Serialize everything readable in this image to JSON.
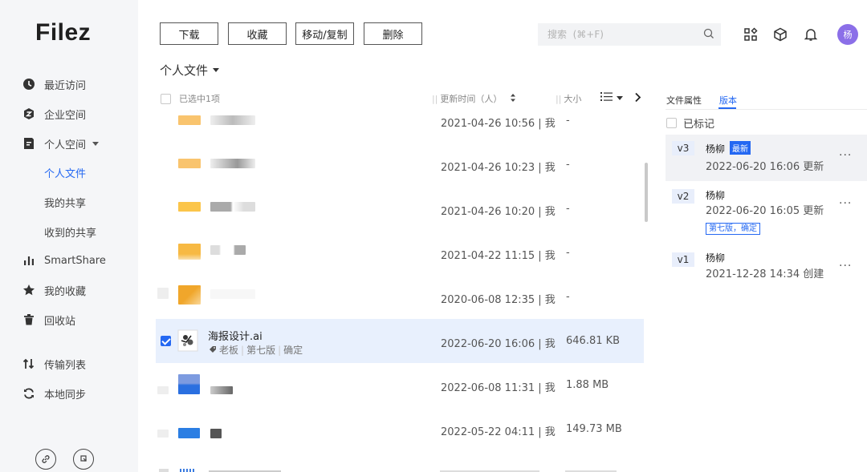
{
  "app": {
    "logo": "Filez"
  },
  "sidebar": {
    "items": [
      {
        "label": "最近访问",
        "icon": "clock-icon"
      },
      {
        "label": "企业空间",
        "icon": "enterprise-icon"
      },
      {
        "label": "个人空间",
        "icon": "personal-space-icon"
      },
      {
        "label": "SmartShare",
        "icon": "bar-chart-icon"
      },
      {
        "label": "我的收藏",
        "icon": "star-icon"
      },
      {
        "label": "回收站",
        "icon": "trash-icon"
      },
      {
        "label": "传输列表",
        "icon": "transfer-icon"
      },
      {
        "label": "本地同步",
        "icon": "sync-icon"
      }
    ],
    "subitems": [
      {
        "label": "个人文件",
        "active": true
      },
      {
        "label": "我的共享",
        "active": false
      },
      {
        "label": "收到的共享",
        "active": false
      }
    ]
  },
  "toolbar": {
    "download": "下载",
    "favorite": "收藏",
    "move_copy": "移动/复制",
    "delete": "删除"
  },
  "search": {
    "placeholder": "搜索  (⌘+F)"
  },
  "header": {
    "avatar_text": "杨"
  },
  "breadcrumb": {
    "title": "个人文件"
  },
  "table": {
    "select_label": "已选中1项",
    "col_time": "更新时间（人）",
    "col_size": "大小"
  },
  "rows": [
    {
      "time": "2021-04-26 10:56 | 我",
      "size": "-"
    },
    {
      "time": "2021-04-26 10:23 | 我",
      "size": "-"
    },
    {
      "time": "2021-04-26 10:20 | 我",
      "size": "-"
    },
    {
      "time": "2021-04-22 11:15 | 我",
      "size": "-"
    },
    {
      "time": "2020-06-08 12:35 | 我",
      "size": "-"
    },
    {
      "time": "2022-06-20 16:06 | 我",
      "size": "646.81 KB",
      "name": "海报设计.ai",
      "tags": [
        "老板",
        "第七版",
        "确定"
      ],
      "selected": true
    },
    {
      "time": "2022-06-08 11:31 | 我",
      "size": "1.88 MB"
    },
    {
      "time": "2022-05-22 04:11 | 我",
      "size": "149.73 MB"
    }
  ],
  "panel": {
    "tabs": [
      "文件属性",
      "版本"
    ],
    "active_tab": "版本",
    "marked_label": "已标记",
    "versions": [
      {
        "tag": "v3",
        "user": "杨柳",
        "badge": "最新",
        "time": "2022-06-20 16:06 更新"
      },
      {
        "tag": "v2",
        "user": "杨柳",
        "time": "2022-06-20 16:05 更新",
        "label": "第七版，确定"
      },
      {
        "tag": "v1",
        "user": "杨柳",
        "time": "2021-12-28 14:34 创建"
      }
    ]
  },
  "colors": {
    "accent": "#2468f2",
    "selected_row": "#e8f0fd",
    "avatar": "#8b6fe8",
    "sidebar_bg": "#f5f6f8"
  }
}
